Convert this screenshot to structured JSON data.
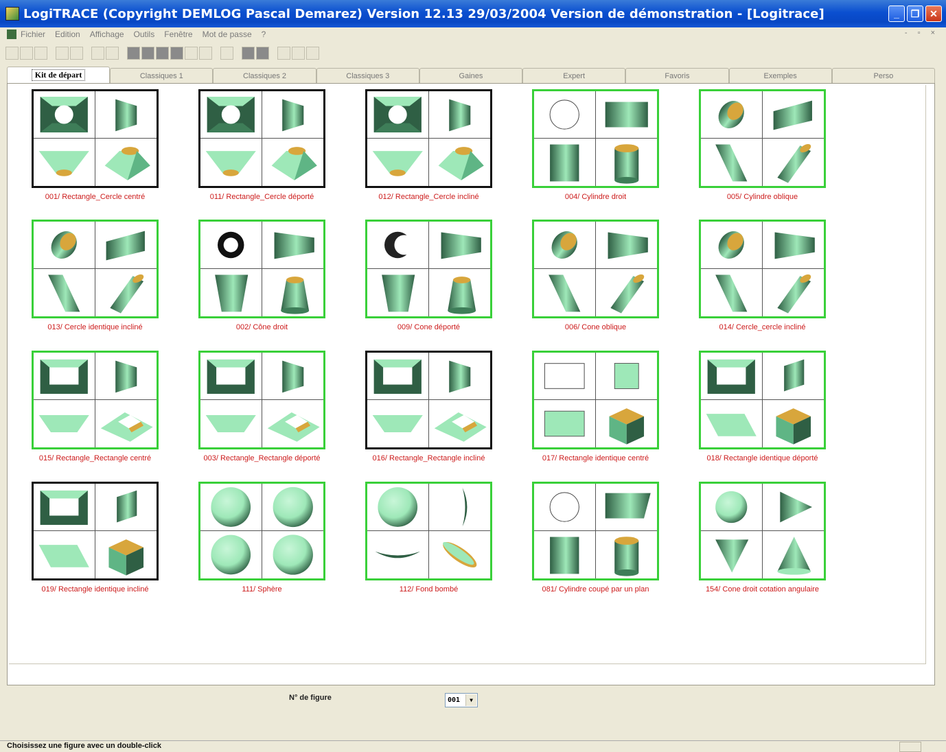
{
  "window": {
    "title": "LogiTRACE  (Copyright DEMLOG Pascal Demarez)  Version 12.13 29/03/2004  Version de démonstration - [Logitrace]",
    "minimize_glyph": "_",
    "restore_glyph": "❐",
    "close_glyph": "✕"
  },
  "menu": [
    "Fichier",
    "Edition",
    "Affichage",
    "Outils",
    "Fenêtre",
    "Mot de passe",
    "?"
  ],
  "mdi_controls": "- ▫ ×",
  "tabs": [
    "Kit de départ",
    "Classiques 1",
    "Classiques 2",
    "Classiques 3",
    "Gaines",
    "Expert",
    "Favoris",
    "Exemples",
    "Perso"
  ],
  "active_tab": "Kit de départ",
  "figures": [
    {
      "caption": "001/ Rectangle_Cercle centré",
      "frame": "black",
      "icons": [
        "rect-circle-top",
        "trapezoid-side",
        "funnel-front",
        "frustum-3d"
      ]
    },
    {
      "caption": "011/ Rectangle_Cercle déporté",
      "frame": "black",
      "icons": [
        "rect-circle-top",
        "trapezoid-side",
        "funnel-front",
        "frustum-3d"
      ]
    },
    {
      "caption": "012/ Rectangle_Cercle incliné",
      "frame": "black",
      "icons": [
        "rect-circle-top",
        "trapezoid-side",
        "funnel-front",
        "frustum-3d"
      ]
    },
    {
      "caption": "004/ Cylindre droit",
      "frame": "green",
      "icons": [
        "circle-outline",
        "cylinder-side",
        "cylinder-front",
        "cylinder-3d"
      ]
    },
    {
      "caption": "005/ Cylindre oblique",
      "frame": "green",
      "icons": [
        "oblique-top",
        "oblique-side",
        "oblique-front",
        "oblique-3d"
      ]
    },
    {
      "caption": "013/ Cercle identique incliné",
      "frame": "green",
      "icons": [
        "oblique-top",
        "oblique-side",
        "oblique-front",
        "oblique-3d"
      ]
    },
    {
      "caption": "002/ Cône droit",
      "frame": "green",
      "icons": [
        "ring-top",
        "cone-side",
        "cone-front",
        "cone-3d"
      ]
    },
    {
      "caption": "009/ Cone déporté",
      "frame": "green",
      "icons": [
        "crescent-top",
        "cone-side",
        "cone-front",
        "cone-3d"
      ]
    },
    {
      "caption": "006/ Cone oblique",
      "frame": "green",
      "icons": [
        "oblique-top",
        "cone-side",
        "oblique-front",
        "oblique-3d"
      ]
    },
    {
      "caption": "014/ Cercle_cercle incliné",
      "frame": "green",
      "icons": [
        "oblique-top",
        "cone-side",
        "oblique-front",
        "oblique-3d"
      ]
    },
    {
      "caption": "015/ Rectangle_Rectangle centré",
      "frame": "green",
      "icons": [
        "rect-rect-top",
        "trapezoid-side",
        "trough-front",
        "rect-frustum-3d"
      ]
    },
    {
      "caption": "003/ Rectangle_Rectangle déporté",
      "frame": "green",
      "icons": [
        "rect-rect-top",
        "trapezoid-side",
        "trough-front",
        "rect-frustum-3d"
      ]
    },
    {
      "caption": "016/ Rectangle_Rectangle incliné",
      "frame": "black",
      "icons": [
        "rect-rect-top",
        "trapezoid-side",
        "trough-front",
        "rect-frustum-3d"
      ]
    },
    {
      "caption": "017/ Rectangle identique centré",
      "frame": "green",
      "icons": [
        "rect-outline",
        "square-fill",
        "rect-fill",
        "box-3d"
      ]
    },
    {
      "caption": "018/ Rectangle identique déporté",
      "frame": "green",
      "icons": [
        "rect-rect-top",
        "para-side",
        "para-front",
        "box-3d"
      ]
    },
    {
      "caption": "019/ Rectangle identique incliné",
      "frame": "black",
      "icons": [
        "rect-rect-top",
        "para-side",
        "para-front",
        "box-3d"
      ]
    },
    {
      "caption": "111/ Sphère",
      "frame": "green",
      "icons": [
        "sphere",
        "sphere",
        "sphere",
        "sphere"
      ]
    },
    {
      "caption": "112/ Fond bombé",
      "frame": "green",
      "icons": [
        "sphere",
        "lens-side",
        "dish-front",
        "dish-3d"
      ]
    },
    {
      "caption": "081/ Cylindre coupé par un plan",
      "frame": "green",
      "icons": [
        "circle-outline",
        "cut-side",
        "cylinder-front",
        "cylinder-3d"
      ]
    },
    {
      "caption": "154/ Cone droit cotation angulaire",
      "frame": "green",
      "icons": [
        "cone-top",
        "triangle-right",
        "triangle-down",
        "cone-up"
      ]
    }
  ],
  "figure_number": {
    "label": "N° de figure",
    "value": "001"
  },
  "status": "Choisissez une figure avec un double-click",
  "colors": {
    "shape_light": "#9ee8b8",
    "shape_dark": "#2f5f44",
    "inner": "#d8a63c",
    "caption": "#cc1b1b",
    "frame_green": "#39d039"
  }
}
